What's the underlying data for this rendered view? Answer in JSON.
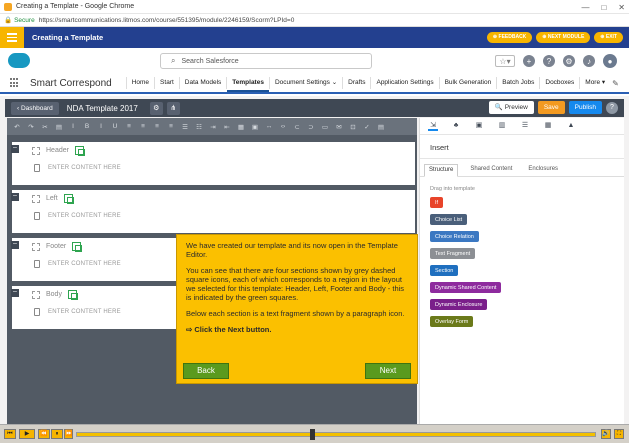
{
  "browser": {
    "tab_title": "Creating a Template - Google Chrome",
    "secure_label": "Secure",
    "url": "https://smartcommunications.litmos.com/course/551395/module/2246159/Scorm?LPId=0",
    "controls": [
      "—",
      "□",
      "✕"
    ]
  },
  "course": {
    "title": "Creating a Template",
    "buttons": [
      "FEEDBACK",
      "NEXT MODULE",
      "EXIT"
    ]
  },
  "salesforce": {
    "search_placeholder": "Search Salesforce",
    "app_name": "Smart Correspond",
    "nav": [
      {
        "label": "Home",
        "active": false
      },
      {
        "label": "Start",
        "active": false
      },
      {
        "label": "Data Models",
        "active": false
      },
      {
        "label": "Templates",
        "active": true
      },
      {
        "label": "Document Settings",
        "active": false
      },
      {
        "label": "Drafts",
        "active": false
      },
      {
        "label": "Application Settings",
        "active": false
      },
      {
        "label": "Bulk Generation",
        "active": false
      },
      {
        "label": "Batch Jobs",
        "active": false
      },
      {
        "label": "Docboxes",
        "active": false
      },
      {
        "label": "More",
        "active": false
      }
    ]
  },
  "editor": {
    "dashboard_label": "Dashboard",
    "template_name": "NDA Template 2017",
    "preview_label": "Preview",
    "save_label": "Save",
    "publish_label": "Publish",
    "sections": [
      {
        "name": "Header",
        "fragment": "ENTER CONTENT HERE"
      },
      {
        "name": "Left",
        "fragment": "ENTER CONTENT HERE"
      },
      {
        "name": "Footer",
        "fragment": "ENTER CONTENT HERE"
      },
      {
        "name": "Body",
        "fragment": "ENTER CONTENT HERE"
      }
    ]
  },
  "panel": {
    "title": "Insert",
    "tabs": [
      "Structure",
      "Shared Content",
      "Enclosures"
    ],
    "drag_label": "Drag into template",
    "chips": [
      {
        "label": "If",
        "color": "#e8442a"
      },
      {
        "label": "Choice List",
        "color": "#4a5f7a"
      },
      {
        "label": "Choice Relation",
        "color": "#3b78c2"
      },
      {
        "label": "Text Fragment",
        "color": "#8c8f94"
      },
      {
        "label": "Section",
        "color": "#1f6fbf"
      },
      {
        "label": "Dynamic Shared Content",
        "color": "#8e2b9e"
      },
      {
        "label": "Dynamic Enclosure",
        "color": "#7a1f8a"
      },
      {
        "label": "Overlay Form",
        "color": "#6b7a1a"
      }
    ]
  },
  "callout": {
    "p1": "We have created our template and its now open in the Template Editor.",
    "p2": "You can see that there are four sections shown by grey dashed square icons, each of which corresponds to a region in the layout we selected for this template: Header, Left, Footer and Body - this is indicated by the green squares.",
    "p3": "Below each section is a text fragment shown by a paragraph icon.",
    "cta": "⇨  Click the Next button.",
    "back_label": "Back",
    "next_label": "Next"
  },
  "player": {
    "progress": 0.45
  }
}
